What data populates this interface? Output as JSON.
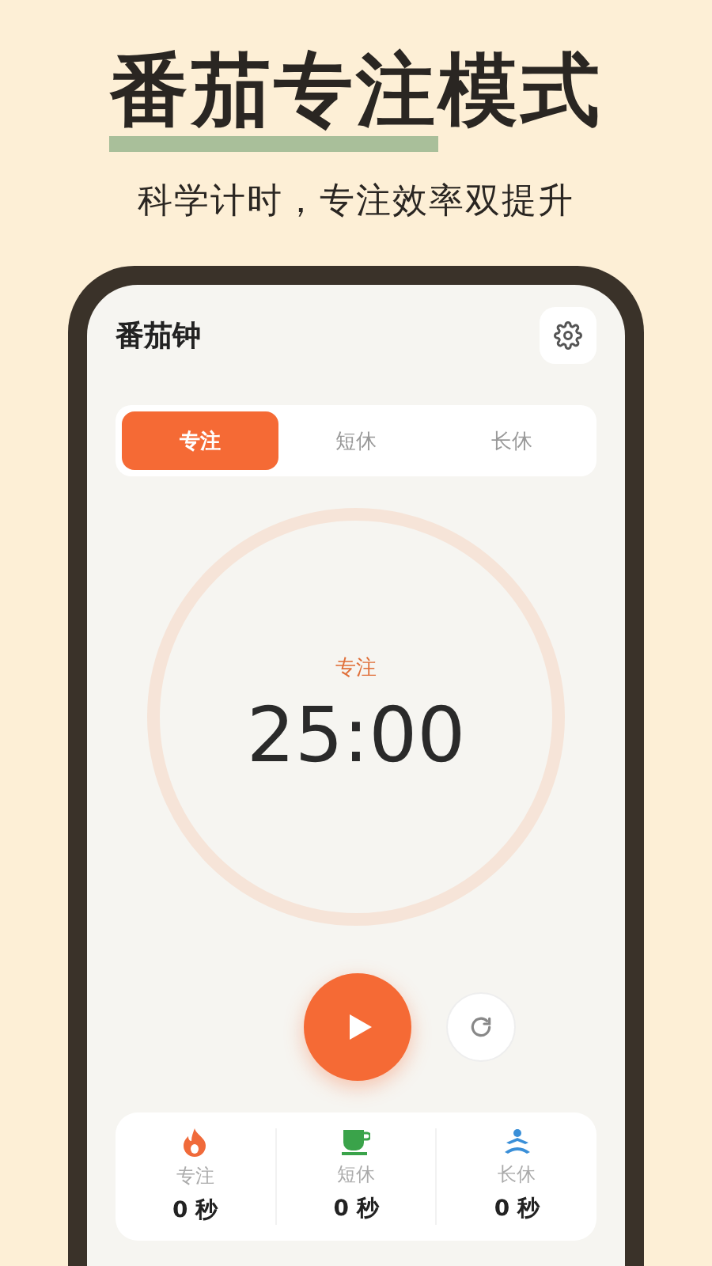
{
  "headline": "番茄专注模式",
  "subtitle": "科学计时，专注效率双提升",
  "app": {
    "title": "番茄钟",
    "tabs": [
      {
        "label": "专注",
        "selected": true
      },
      {
        "label": "短休",
        "selected": false
      },
      {
        "label": "长休",
        "selected": false
      }
    ],
    "timer": {
      "mode": "专注",
      "time": "25:00"
    },
    "stats": [
      {
        "kind": "fire",
        "label": "专注",
        "value": "0 秒"
      },
      {
        "kind": "cup",
        "label": "短休",
        "value": "0 秒"
      },
      {
        "kind": "meditation",
        "label": "长休",
        "value": "0 秒"
      }
    ]
  }
}
